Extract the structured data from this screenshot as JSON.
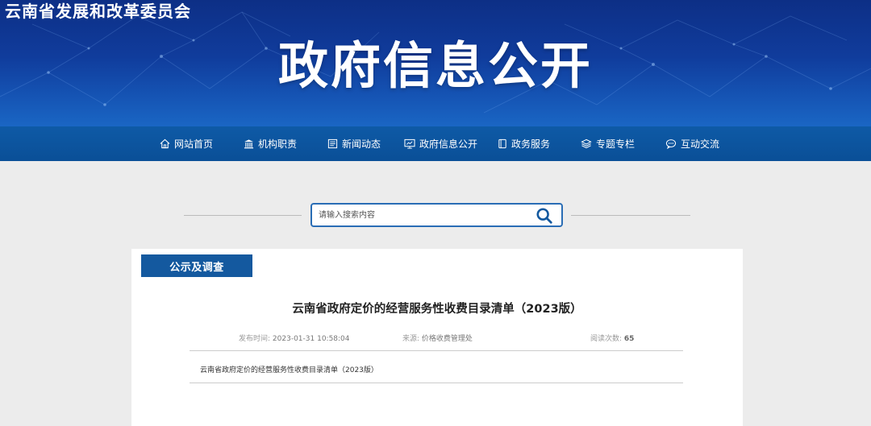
{
  "header": {
    "site_name": "云南省发展和改革委员会",
    "banner_title": "政府信息公开"
  },
  "nav": {
    "items": [
      {
        "label": "网站首页",
        "icon": "home-icon"
      },
      {
        "label": "机构职责",
        "icon": "institution-icon"
      },
      {
        "label": "新闻动态",
        "icon": "news-icon"
      },
      {
        "label": "政府信息公开",
        "icon": "info-disclosure-icon"
      },
      {
        "label": "政务服务",
        "icon": "service-icon"
      },
      {
        "label": "专题专栏",
        "icon": "layers-icon"
      },
      {
        "label": "互动交流",
        "icon": "chat-icon"
      }
    ]
  },
  "search": {
    "placeholder": "请输入搜索内容",
    "icon": "search-icon"
  },
  "section": {
    "tab_label": "公示及调查"
  },
  "article": {
    "title": "云南省政府定价的经营服务性收费目录清单（2023版）",
    "publish_label": "发布时间:",
    "publish_time": "2023-01-31 10:58:04",
    "source_label": "来源:",
    "source": "价格收费管理处",
    "views_label": "阅读次数:",
    "views": "65",
    "attachment": "云南省政府定价的经营服务性收费目录清单（2023版）"
  },
  "colors": {
    "banner_dark": "#0d2f86",
    "nav_blue": "#0e5aa6",
    "tab_blue": "#14599f",
    "search_border": "#2a6db5"
  }
}
